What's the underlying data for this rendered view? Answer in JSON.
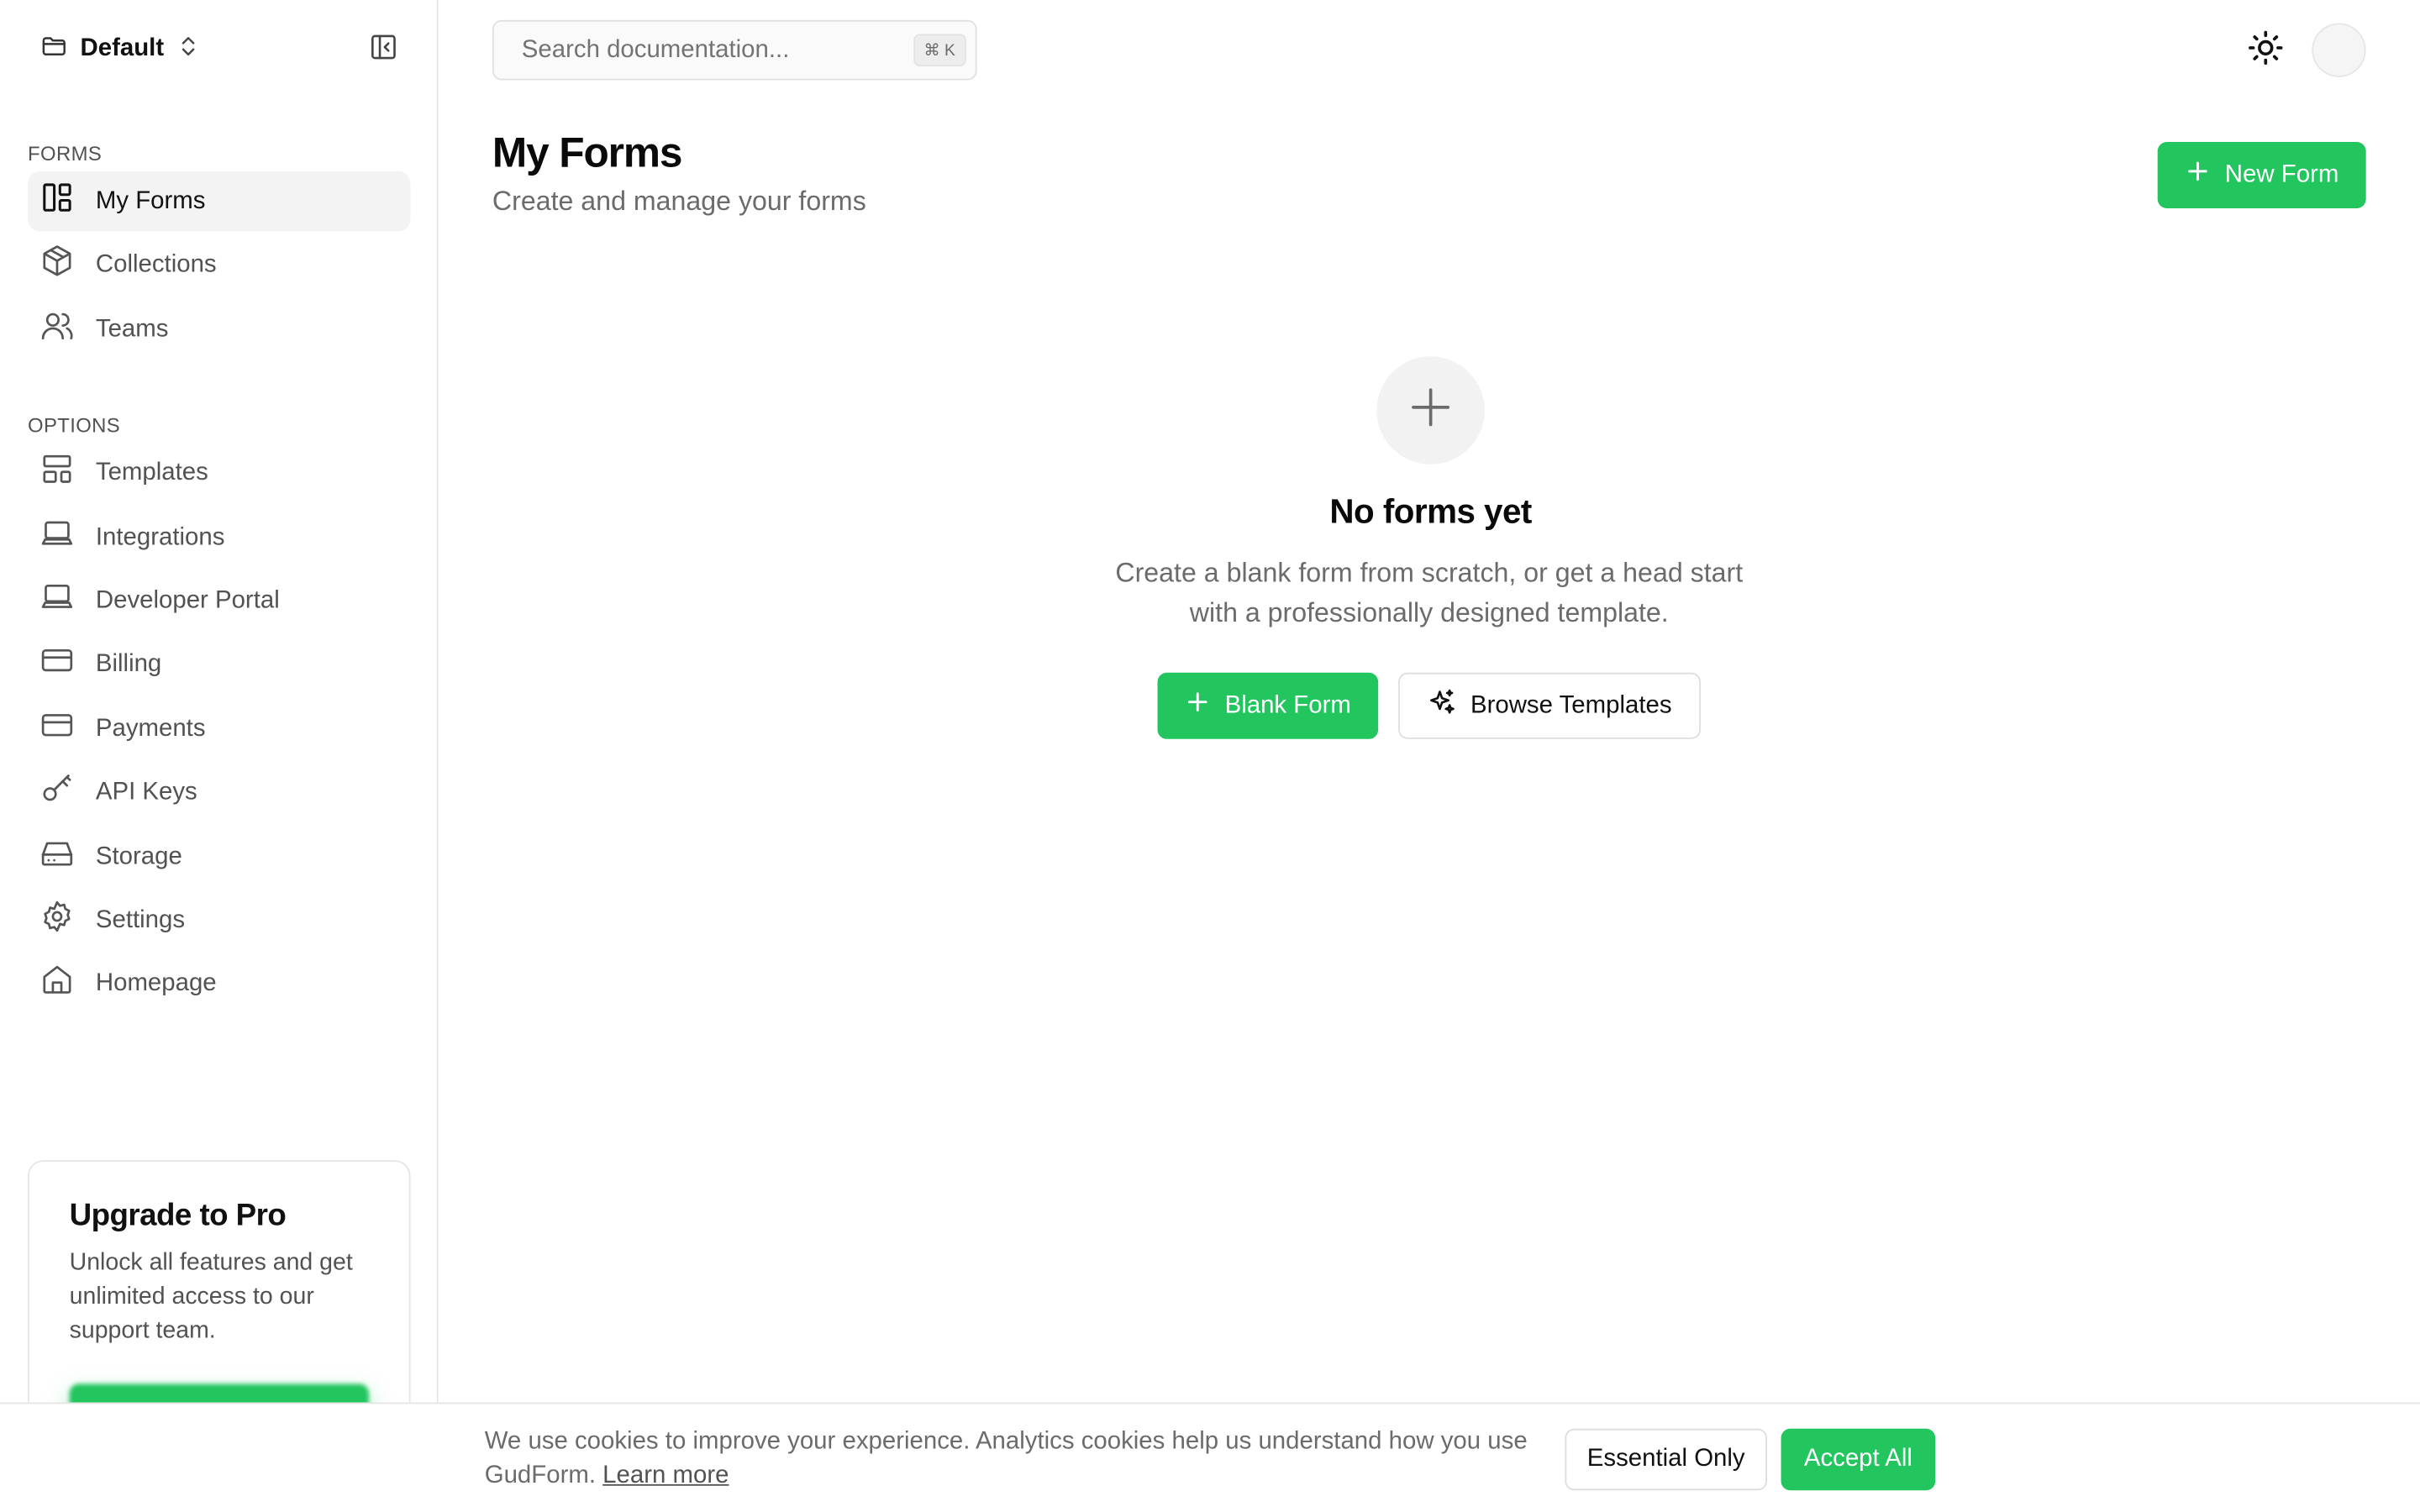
{
  "workspace": {
    "name": "Default"
  },
  "sidebar": {
    "sections": [
      {
        "label": "FORMS",
        "items": [
          {
            "label": "My Forms",
            "icon": "layout-dashboard-icon",
            "active": true
          },
          {
            "label": "Collections",
            "icon": "package-icon",
            "active": false
          },
          {
            "label": "Teams",
            "icon": "users-icon",
            "active": false
          }
        ]
      },
      {
        "label": "OPTIONS",
        "items": [
          {
            "label": "Templates",
            "icon": "layout-template-icon"
          },
          {
            "label": "Integrations",
            "icon": "laptop-icon"
          },
          {
            "label": "Developer Portal",
            "icon": "laptop-icon"
          },
          {
            "label": "Billing",
            "icon": "credit-card-icon"
          },
          {
            "label": "Payments",
            "icon": "credit-card-icon"
          },
          {
            "label": "API Keys",
            "icon": "key-icon"
          },
          {
            "label": "Storage",
            "icon": "hard-drive-icon"
          },
          {
            "label": "Settings",
            "icon": "settings-icon"
          },
          {
            "label": "Homepage",
            "icon": "home-icon"
          }
        ]
      }
    ],
    "upgrade": {
      "title": "Upgrade to Pro",
      "text": "Unlock all features and get unlimited access to our support team."
    }
  },
  "topbar": {
    "search_placeholder": "Search documentation...",
    "search_shortcut": "⌘ K"
  },
  "main": {
    "title": "My Forms",
    "subtitle": "Create and manage your forms",
    "new_form_label": "New Form",
    "empty_state": {
      "title": "No forms yet",
      "text": "Create a blank form from scratch, or get a head start with a professionally designed template.",
      "blank_form_label": "Blank Form",
      "browse_templates_label": "Browse Templates"
    }
  },
  "cookie_banner": {
    "text": "We use cookies to improve your experience. Analytics cookies help us understand how you use GudForm.",
    "link_label": "Learn more",
    "essential_label": "Essential Only",
    "accept_label": "Accept All"
  },
  "colors": {
    "accent": "#22c55e",
    "text_primary": "#0a0a0a",
    "text_muted": "#6b6b6b",
    "border": "#e5e5e5"
  }
}
